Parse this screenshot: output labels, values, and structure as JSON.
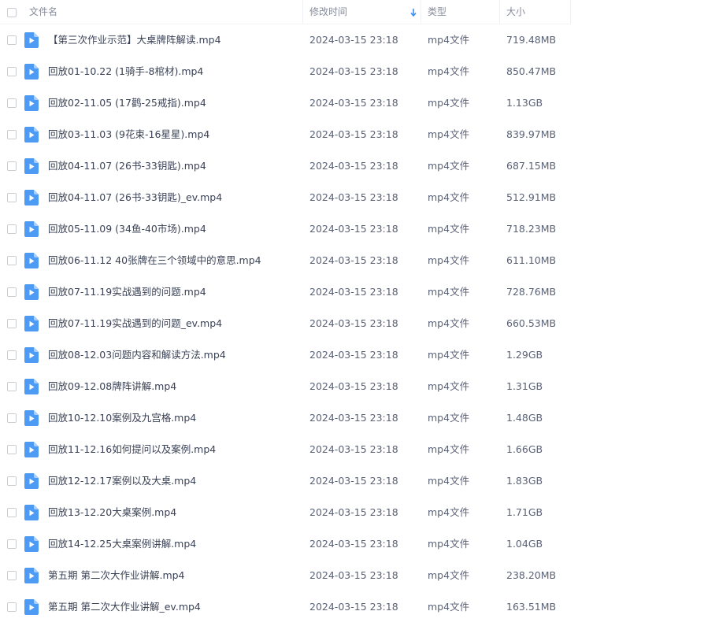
{
  "header": {
    "name_label": "文件名",
    "time_label": "修改时间",
    "type_label": "类型",
    "size_label": "大小"
  },
  "rows": [
    {
      "name": "【第三次作业示范】大桌牌阵解读.mp4",
      "time": "2024-03-15 23:18",
      "type": "mp4文件",
      "size": "719.48MB"
    },
    {
      "name": "回放01-10.22 (1骑手-8棺材).mp4",
      "time": "2024-03-15 23:18",
      "type": "mp4文件",
      "size": "850.47MB"
    },
    {
      "name": "回放02-11.05 (17鹳-25戒指).mp4",
      "time": "2024-03-15 23:18",
      "type": "mp4文件",
      "size": "1.13GB"
    },
    {
      "name": "回放03-11.03 (9花束-16星星).mp4",
      "time": "2024-03-15 23:18",
      "type": "mp4文件",
      "size": "839.97MB"
    },
    {
      "name": "回放04-11.07 (26书-33钥匙).mp4",
      "time": "2024-03-15 23:18",
      "type": "mp4文件",
      "size": "687.15MB"
    },
    {
      "name": "回放04-11.07 (26书-33钥匙)_ev.mp4",
      "time": "2024-03-15 23:18",
      "type": "mp4文件",
      "size": "512.91MB"
    },
    {
      "name": "回放05-11.09 (34鱼-40市场).mp4",
      "time": "2024-03-15 23:18",
      "type": "mp4文件",
      "size": "718.23MB"
    },
    {
      "name": "回放06-11.12 40张牌在三个领域中的意思.mp4",
      "time": "2024-03-15 23:18",
      "type": "mp4文件",
      "size": "611.10MB"
    },
    {
      "name": "回放07-11.19实战遇到的问题.mp4",
      "time": "2024-03-15 23:18",
      "type": "mp4文件",
      "size": "728.76MB"
    },
    {
      "name": "回放07-11.19实战遇到的问题_ev.mp4",
      "time": "2024-03-15 23:18",
      "type": "mp4文件",
      "size": "660.53MB"
    },
    {
      "name": "回放08-12.03问题内容和解读方法.mp4",
      "time": "2024-03-15 23:18",
      "type": "mp4文件",
      "size": "1.29GB"
    },
    {
      "name": "回放09-12.08牌阵讲解.mp4",
      "time": "2024-03-15 23:18",
      "type": "mp4文件",
      "size": "1.31GB"
    },
    {
      "name": "回放10-12.10案例及九宫格.mp4",
      "time": "2024-03-15 23:18",
      "type": "mp4文件",
      "size": "1.48GB"
    },
    {
      "name": "回放11-12.16如何提问以及案例.mp4",
      "time": "2024-03-15 23:18",
      "type": "mp4文件",
      "size": "1.66GB"
    },
    {
      "name": "回放12-12.17案例以及大桌.mp4",
      "time": "2024-03-15 23:18",
      "type": "mp4文件",
      "size": "1.83GB"
    },
    {
      "name": "回放13-12.20大桌案例.mp4",
      "time": "2024-03-15 23:18",
      "type": "mp4文件",
      "size": "1.71GB"
    },
    {
      "name": "回放14-12.25大桌案例讲解.mp4",
      "time": "2024-03-15 23:18",
      "type": "mp4文件",
      "size": "1.04GB"
    },
    {
      "name": "第五期 第二次大作业讲解.mp4",
      "time": "2024-03-15 23:18",
      "type": "mp4文件",
      "size": "238.20MB"
    },
    {
      "name": "第五期 第二次大作业讲解_ev.mp4",
      "time": "2024-03-15 23:18",
      "type": "mp4文件",
      "size": "163.51MB"
    }
  ],
  "colors": {
    "file_icon": "#4e9bf5",
    "sort_arrow": "#3d8ef2"
  },
  "icons": {
    "file": "video-file-icon",
    "sort": "sort-down-arrow-icon",
    "checkbox": "checkbox-icon"
  }
}
